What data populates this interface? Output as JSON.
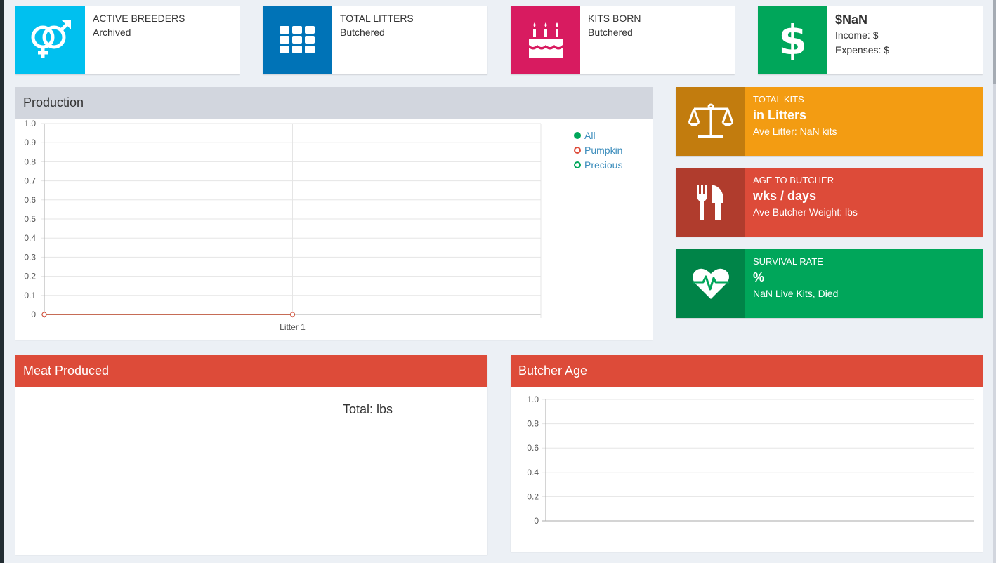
{
  "colors": {
    "aqua": "#00c0ef",
    "blue": "#0073b7",
    "maroon": "#d81b60",
    "green": "#00a65a",
    "orange": "#f39c12",
    "red": "#dd4b39",
    "pumpkin": "#dd4b39",
    "precious": "#00a65a"
  },
  "info_boxes": {
    "breeders": {
      "icon": "gender-icon",
      "title": "ACTIVE BREEDERS",
      "sub": "Archived"
    },
    "litters": {
      "icon": "grid-icon",
      "title": "TOTAL LITTERS",
      "sub": "Butchered"
    },
    "kits": {
      "icon": "birthday-cake-icon",
      "title": "KITS BORN",
      "sub": "Butchered"
    },
    "money": {
      "icon": "dollar-icon",
      "amount": "$NaN",
      "income": "Income: $",
      "expenses": "Expenses: $"
    }
  },
  "stat_boxes": {
    "total_kits": {
      "icon": "balance-scale-icon",
      "label": "TOTAL KITS",
      "value": "in Litters",
      "detail": "Ave Litter: NaN kits"
    },
    "age_butcher": {
      "icon": "cutlery-icon",
      "label": "AGE TO BUTCHER",
      "value": "wks / days",
      "detail": "Ave Butcher Weight: lbs"
    },
    "survival": {
      "icon": "heartbeat-icon",
      "label": "SURVIVAL RATE",
      "value": "%",
      "detail": "NaN Live Kits, Died"
    }
  },
  "production": {
    "title": "Production",
    "legend": [
      "All",
      "Pumpkin",
      "Precious"
    ]
  },
  "meat": {
    "title": "Meat Produced",
    "total": "Total: lbs"
  },
  "butcher_age": {
    "title": "Butcher Age"
  },
  "chart_data": [
    {
      "type": "line",
      "title": "Production",
      "categories": [
        "",
        "Litter 1",
        ""
      ],
      "yticks": [
        "0",
        "0.1",
        "0.2",
        "0.3",
        "0.4",
        "0.5",
        "0.6",
        "0.7",
        "0.8",
        "0.9",
        "1.0"
      ],
      "ylim": [
        0,
        1
      ],
      "grid": true,
      "legend_position": "top-right",
      "series": [
        {
          "name": "All",
          "values": [
            0,
            0,
            null
          ],
          "color": "#00a65a"
        },
        {
          "name": "Pumpkin",
          "values": [
            0,
            0,
            null
          ],
          "color": "#dd4b39"
        },
        {
          "name": "Precious",
          "values": [
            null,
            null,
            null
          ],
          "color": "#00a65a"
        }
      ]
    },
    {
      "type": "bar",
      "title": "Butcher Age",
      "categories": [],
      "yticks": [
        "0",
        "0.2",
        "0.4",
        "0.6",
        "0.8",
        "1.0"
      ],
      "ylim": [
        0,
        1
      ],
      "grid": true,
      "series": []
    }
  ]
}
